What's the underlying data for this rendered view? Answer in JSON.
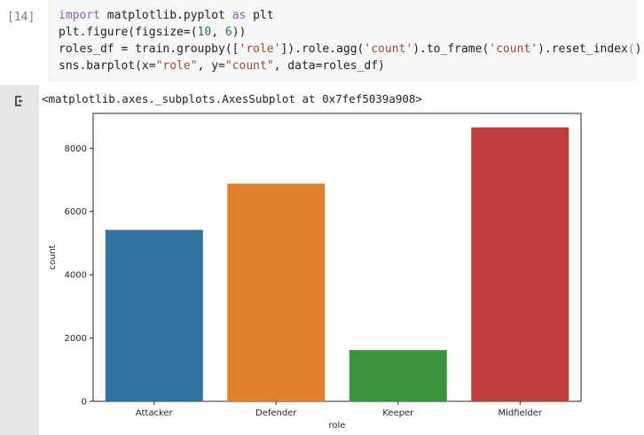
{
  "cell": {
    "execution_count": "[14]",
    "code_lines": [
      [
        {
          "t": "import",
          "c": "kw"
        },
        {
          "t": " matplotlib.pyplot "
        },
        {
          "t": "as",
          "c": "kw"
        },
        {
          "t": " plt"
        }
      ],
      [
        {
          "t": "plt.figure(figsize=("
        },
        {
          "t": "10",
          "c": "num"
        },
        {
          "t": ", "
        },
        {
          "t": "6",
          "c": "num"
        },
        {
          "t": "))"
        }
      ],
      [
        {
          "t": "roles_df = train.groupby(["
        },
        {
          "t": "'role'",
          "c": "str"
        },
        {
          "t": "]).role.agg("
        },
        {
          "t": "'count'",
          "c": "str"
        },
        {
          "t": ").to_frame("
        },
        {
          "t": "'count'",
          "c": "str"
        },
        {
          "t": ").reset_index()"
        }
      ],
      [
        {
          "t": "sns.barplot(x="
        },
        {
          "t": "\"role\"",
          "c": "str"
        },
        {
          "t": ", y="
        },
        {
          "t": "\"count\"",
          "c": "str"
        },
        {
          "t": ", data=roles_df)"
        }
      ]
    ],
    "output_text": "<matplotlib.axes._subplots.AxesSubplot at 0x7fef5039a908>",
    "output_icon": "output-arrow-icon"
  },
  "chart_data": {
    "type": "bar",
    "categories": [
      "Attacker",
      "Defender",
      "Keeper",
      "Midfielder"
    ],
    "values": [
      5420,
      6880,
      1620,
      8660
    ],
    "colors": [
      "#3274a1",
      "#e1812c",
      "#3a923a",
      "#c03d3e"
    ],
    "xlabel": "role",
    "ylabel": "count",
    "ylim": [
      0,
      9100
    ],
    "yticks": [
      0,
      2000,
      4000,
      6000,
      8000
    ],
    "grid": false
  }
}
